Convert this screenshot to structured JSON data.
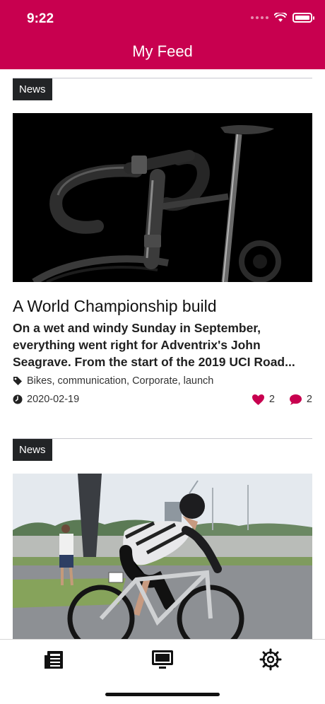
{
  "status_bar": {
    "time": "9:22"
  },
  "header": {
    "title": "My Feed"
  },
  "cards": [
    {
      "badge": "News",
      "title": "A World Championship build",
      "excerpt": "On a wet and windy Sunday in September, everything went right for Adventrix's John Seagrave. From the start of the 2019 UCI Road...",
      "tags": "Bikes, communication, Corporate, launch",
      "date": "2020-02-19",
      "likes": "2",
      "comments": "2"
    },
    {
      "badge": "News"
    }
  ],
  "tabbar": {
    "icons": [
      "newspaper-icon",
      "monitor-icon",
      "settings-gear-icon"
    ]
  },
  "colors": {
    "accent": "#c8004f",
    "badge_bg": "#222426"
  }
}
